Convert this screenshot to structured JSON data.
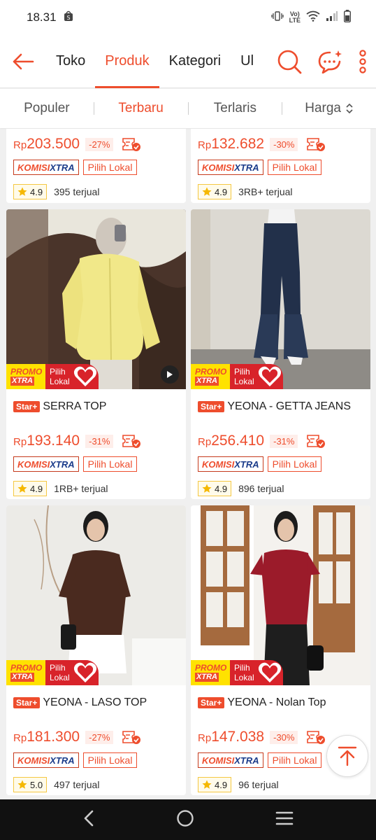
{
  "status_bar": {
    "time": "18.31",
    "network": "VoLTE"
  },
  "nav": {
    "tabs": [
      "Toko",
      "Produk",
      "Kategori",
      "Ul"
    ],
    "active_tab": "Produk"
  },
  "sort": {
    "items": [
      "Populer",
      "Terbaru",
      "Terlaris",
      "Harga"
    ],
    "active": "Terbaru"
  },
  "colors": {
    "brand": "#ee4d2d",
    "rating_star": "#f5b800"
  },
  "badges": {
    "komisi_a": "KOMISI",
    "komisi_b": "XTRA",
    "pilih_lokal": "Pilih Lokal",
    "star_plus": "Star+",
    "promo_top": "PROMO",
    "promo_bottom": "XTRA",
    "pilih_1": "Pilih",
    "pilih_2": "Lokal"
  },
  "products": [
    {
      "name": "",
      "currency": "Rp",
      "price": "203.500",
      "discount": "-27%",
      "rating": "4.9",
      "sold": "395 terjual"
    },
    {
      "name": "",
      "currency": "Rp",
      "price": "132.682",
      "discount": "-30%",
      "rating": "4.9",
      "sold": "3RB+ terjual"
    },
    {
      "name": "SERRA TOP",
      "currency": "Rp",
      "price": "193.140",
      "discount": "-31%",
      "rating": "4.9",
      "sold": "1RB+ terjual"
    },
    {
      "name": "YEONA - GETTA JEANS",
      "currency": "Rp",
      "price": "256.410",
      "discount": "-31%",
      "rating": "4.9",
      "sold": "896 terjual"
    },
    {
      "name": "YEONA - LASO TOP",
      "currency": "Rp",
      "price": "181.300",
      "discount": "-27%",
      "rating": "5.0",
      "sold": "497 terjual"
    },
    {
      "name": "YEONA - Nolan Top",
      "currency": "Rp",
      "price": "147.038",
      "discount": "-30%",
      "rating": "4.9",
      "sold": "96 terjual"
    }
  ]
}
